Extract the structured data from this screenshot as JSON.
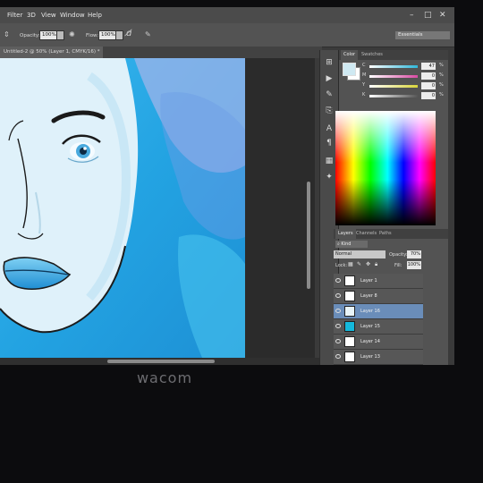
{
  "menu": {
    "items": [
      "Filter",
      "3D",
      "View",
      "Window",
      "Help"
    ]
  },
  "options_bar": {
    "opacity_label": "Opacity:",
    "opacity_value": "100%",
    "flow_label": "Flow:",
    "flow_value": "100%",
    "workspace": "Essentials"
  },
  "document": {
    "tab_title": "Untitled-2 @ 50% (Layer 1, CMYK/16) *"
  },
  "color_panel": {
    "tabs": [
      "Color",
      "Swatches"
    ],
    "sliders": [
      {
        "label": "C",
        "value": "47",
        "unit": "%",
        "color": "#2fb7d9"
      },
      {
        "label": "M",
        "value": "0",
        "unit": "%",
        "color": "#d94aa3"
      },
      {
        "label": "Y",
        "value": "0",
        "unit": "%",
        "color": "#d8d43a"
      },
      {
        "label": "K",
        "value": "0",
        "unit": "%",
        "color": "#555555"
      }
    ]
  },
  "layers_panel": {
    "tabs": [
      "Layers",
      "Channels",
      "Paths"
    ],
    "kind_label": "Kind",
    "blend_mode": "Normal",
    "opacity_label": "Opacity:",
    "opacity_value": "70%",
    "lock_label": "Lock:",
    "fill_label": "Fill:",
    "fill_value": "100%",
    "layers": [
      {
        "name": "Layer 1",
        "selected": false,
        "thumb": "#ffffff"
      },
      {
        "name": "Layer 8",
        "selected": false,
        "thumb": "#ffffff"
      },
      {
        "name": "Layer 16",
        "selected": true,
        "thumb": "#e8f4f8"
      },
      {
        "name": "Layer 15",
        "selected": false,
        "thumb": "#14b9dc"
      },
      {
        "name": "Layer 14",
        "selected": false,
        "thumb": "#ffffff"
      },
      {
        "name": "Layer 13",
        "selected": false,
        "thumb": "#ffffff"
      }
    ]
  },
  "monitor": {
    "brand": "wacom"
  }
}
